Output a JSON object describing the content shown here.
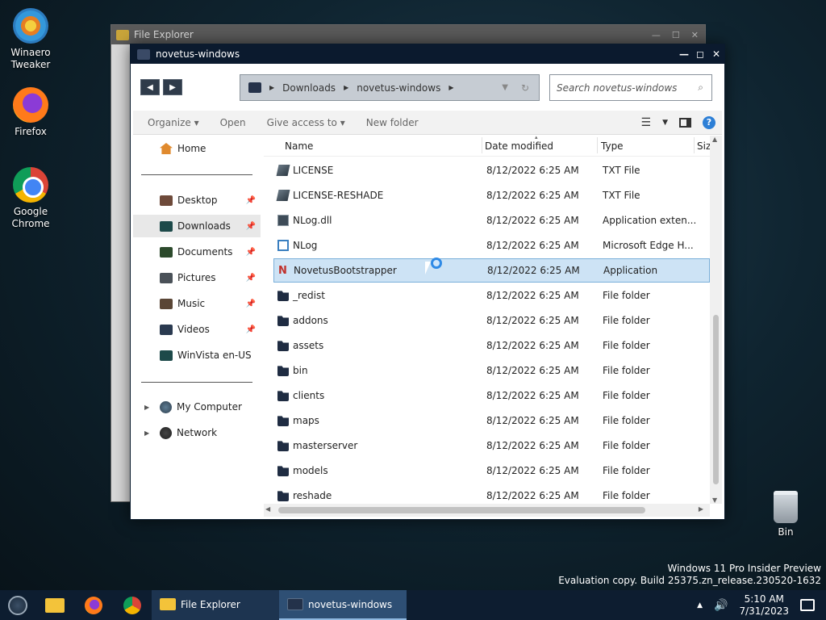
{
  "desktop": {
    "icons": [
      {
        "label_line1": "Winaero",
        "label_line2": "Tweaker"
      },
      {
        "label_line1": "Firefox",
        "label_line2": ""
      },
      {
        "label_line1": "Google",
        "label_line2": "Chrome"
      }
    ],
    "bin": {
      "label": "Bin"
    }
  },
  "bg_window": {
    "title": "File Explorer"
  },
  "window": {
    "title": "novetus-windows",
    "address": {
      "crumbs": [
        "Downloads",
        "novetus-windows"
      ]
    },
    "search": {
      "placeholder": "Search novetus-windows"
    },
    "toolbar": {
      "organize": "Organize",
      "open": "Open",
      "give_access": "Give access to",
      "new_folder": "New folder"
    },
    "nav": {
      "home": "Home",
      "quick": [
        {
          "label": "Desktop",
          "pinned": true
        },
        {
          "label": "Downloads",
          "pinned": true
        },
        {
          "label": "Documents",
          "pinned": true
        },
        {
          "label": "Pictures",
          "pinned": true
        },
        {
          "label": "Music",
          "pinned": true
        },
        {
          "label": "Videos",
          "pinned": true
        },
        {
          "label": "WinVista en-US",
          "pinned": false
        }
      ],
      "my_computer": "My Computer",
      "network": "Network"
    },
    "columns": {
      "name": "Name",
      "date": "Date modified",
      "type": "Type",
      "size": "Siz"
    },
    "files": [
      {
        "name": "LICENSE",
        "date": "8/12/2022 6:25 AM",
        "type": "TXT File",
        "icon": "txt-file-icon"
      },
      {
        "name": "LICENSE-RESHADE",
        "date": "8/12/2022 6:25 AM",
        "type": "TXT File",
        "icon": "txt-file-icon"
      },
      {
        "name": "NLog.dll",
        "date": "8/12/2022 6:25 AM",
        "type": "Application exten...",
        "icon": "dll-file-icon"
      },
      {
        "name": "NLog",
        "date": "8/12/2022 6:25 AM",
        "type": "Microsoft Edge H...",
        "icon": "html-file-icon"
      },
      {
        "name": "NovetusBootstrapper",
        "date": "8/12/2022 6:25 AM",
        "type": "Application",
        "icon": "app-icon"
      },
      {
        "name": "_redist",
        "date": "8/12/2022 6:25 AM",
        "type": "File folder",
        "icon": "folder-icon"
      },
      {
        "name": "addons",
        "date": "8/12/2022 6:25 AM",
        "type": "File folder",
        "icon": "folder-icon"
      },
      {
        "name": "assets",
        "date": "8/12/2022 6:25 AM",
        "type": "File folder",
        "icon": "folder-icon"
      },
      {
        "name": "bin",
        "date": "8/12/2022 6:25 AM",
        "type": "File folder",
        "icon": "folder-icon"
      },
      {
        "name": "clients",
        "date": "8/12/2022 6:25 AM",
        "type": "File folder",
        "icon": "folder-icon"
      },
      {
        "name": "maps",
        "date": "8/12/2022 6:25 AM",
        "type": "File folder",
        "icon": "folder-icon"
      },
      {
        "name": "masterserver",
        "date": "8/12/2022 6:25 AM",
        "type": "File folder",
        "icon": "folder-icon"
      },
      {
        "name": "models",
        "date": "8/12/2022 6:25 AM",
        "type": "File folder",
        "icon": "folder-icon"
      },
      {
        "name": "reshade",
        "date": "8/12/2022 6:25 AM",
        "type": "File folder",
        "icon": "folder-icon"
      }
    ]
  },
  "watermark": {
    "line1": "Windows 11 Pro Insider Preview",
    "line2": "Evaluation copy. Build 25375.zn_release.230520-1632"
  },
  "taskbar": {
    "tasks": [
      {
        "label": "File Explorer"
      },
      {
        "label": "novetus-windows"
      }
    ],
    "time": "5:10 AM",
    "date": "7/31/2023"
  }
}
